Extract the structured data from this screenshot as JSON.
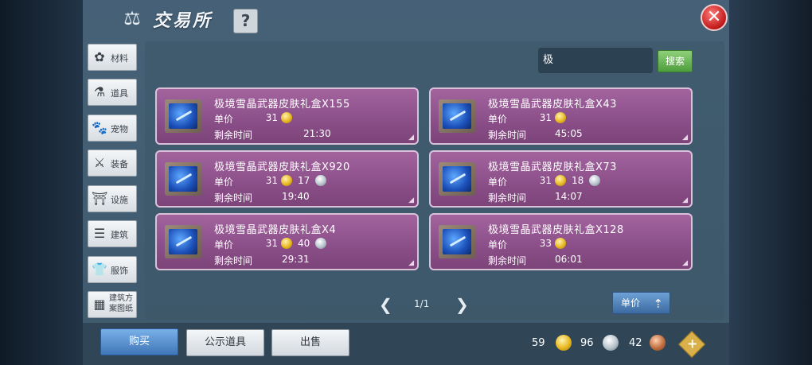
{
  "header": {
    "title": "交易所",
    "help_label": "?",
    "close_label": "✕",
    "scale_icon": "⚖"
  },
  "sidebar": {
    "items": [
      {
        "label": "材料",
        "icon": "✿"
      },
      {
        "label": "道具",
        "icon": "⚗"
      },
      {
        "label": "宠物",
        "icon": "🐾"
      },
      {
        "label": "装备",
        "icon": "⚔"
      },
      {
        "label": "设施",
        "icon": "⛩"
      },
      {
        "label": "建筑",
        "icon": "☰"
      },
      {
        "label": "服饰",
        "icon": "👕"
      },
      {
        "label": "建筑方案图纸",
        "icon": "▦"
      }
    ]
  },
  "search": {
    "value": "极",
    "button_label": "搜索"
  },
  "labels": {
    "unit_price": "单价",
    "remaining_time": "剩余时间"
  },
  "listings": [
    {
      "name": "极境雪晶武器皮肤礼盒X155",
      "gold": "31",
      "silver": "",
      "time": "21:30"
    },
    {
      "name": "极境雪晶武器皮肤礼盒X43",
      "gold": "31",
      "silver": "",
      "time": "45:05"
    },
    {
      "name": "极境雪晶武器皮肤礼盒X920",
      "gold": "31",
      "silver": "17",
      "time": "19:40"
    },
    {
      "name": "极境雪晶武器皮肤礼盒X73",
      "gold": "31",
      "silver": "18",
      "time": "14:07"
    },
    {
      "name": "极境雪晶武器皮肤礼盒X4",
      "gold": "31",
      "silver": "40",
      "time": "29:31"
    },
    {
      "name": "极境雪晶武器皮肤礼盒X128",
      "gold": "33",
      "silver": "",
      "time": "06:01"
    }
  ],
  "pager": {
    "prev": "❮",
    "next": "❯",
    "page": "1/1"
  },
  "sort": {
    "label": "单价",
    "icon": "⇡"
  },
  "bottom": {
    "buy_label": "购买",
    "public_label": "公示道具",
    "sell_label": "出售"
  },
  "currency": {
    "gold": "59",
    "silver": "96",
    "copper": "42",
    "add_label": "+"
  }
}
